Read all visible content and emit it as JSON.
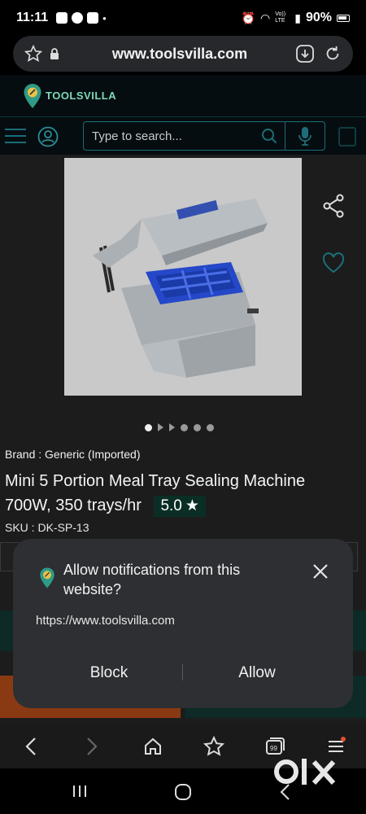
{
  "status_bar": {
    "time": "11:11",
    "battery": "90%",
    "volte": "Vo)) LTE"
  },
  "browser": {
    "url": "www.toolsvilla.com"
  },
  "site": {
    "logo_text": "TOOLSVILLA",
    "search": {
      "placeholder": "Type to search..."
    }
  },
  "product": {
    "brand_line": "Brand : Generic (Imported)",
    "title": "Mini 5 Portion Meal Tray Sealing Machine 700W, 350 trays/hr",
    "rating": "5.0",
    "rating_star": "★",
    "sku": "SKU : DK-SP-13",
    "image_dots": 5,
    "active_dot": 0
  },
  "notification_dialog": {
    "title": "Allow notifications from this website?",
    "url": "https://www.toolsvilla.com",
    "block_label": "Block",
    "allow_label": "Allow"
  },
  "colors": {
    "accent": "#1c6e78",
    "logo_green": "#7ed8b9",
    "rating_bg": "#0a2e25",
    "dialog_bg": "#2d2f33"
  }
}
